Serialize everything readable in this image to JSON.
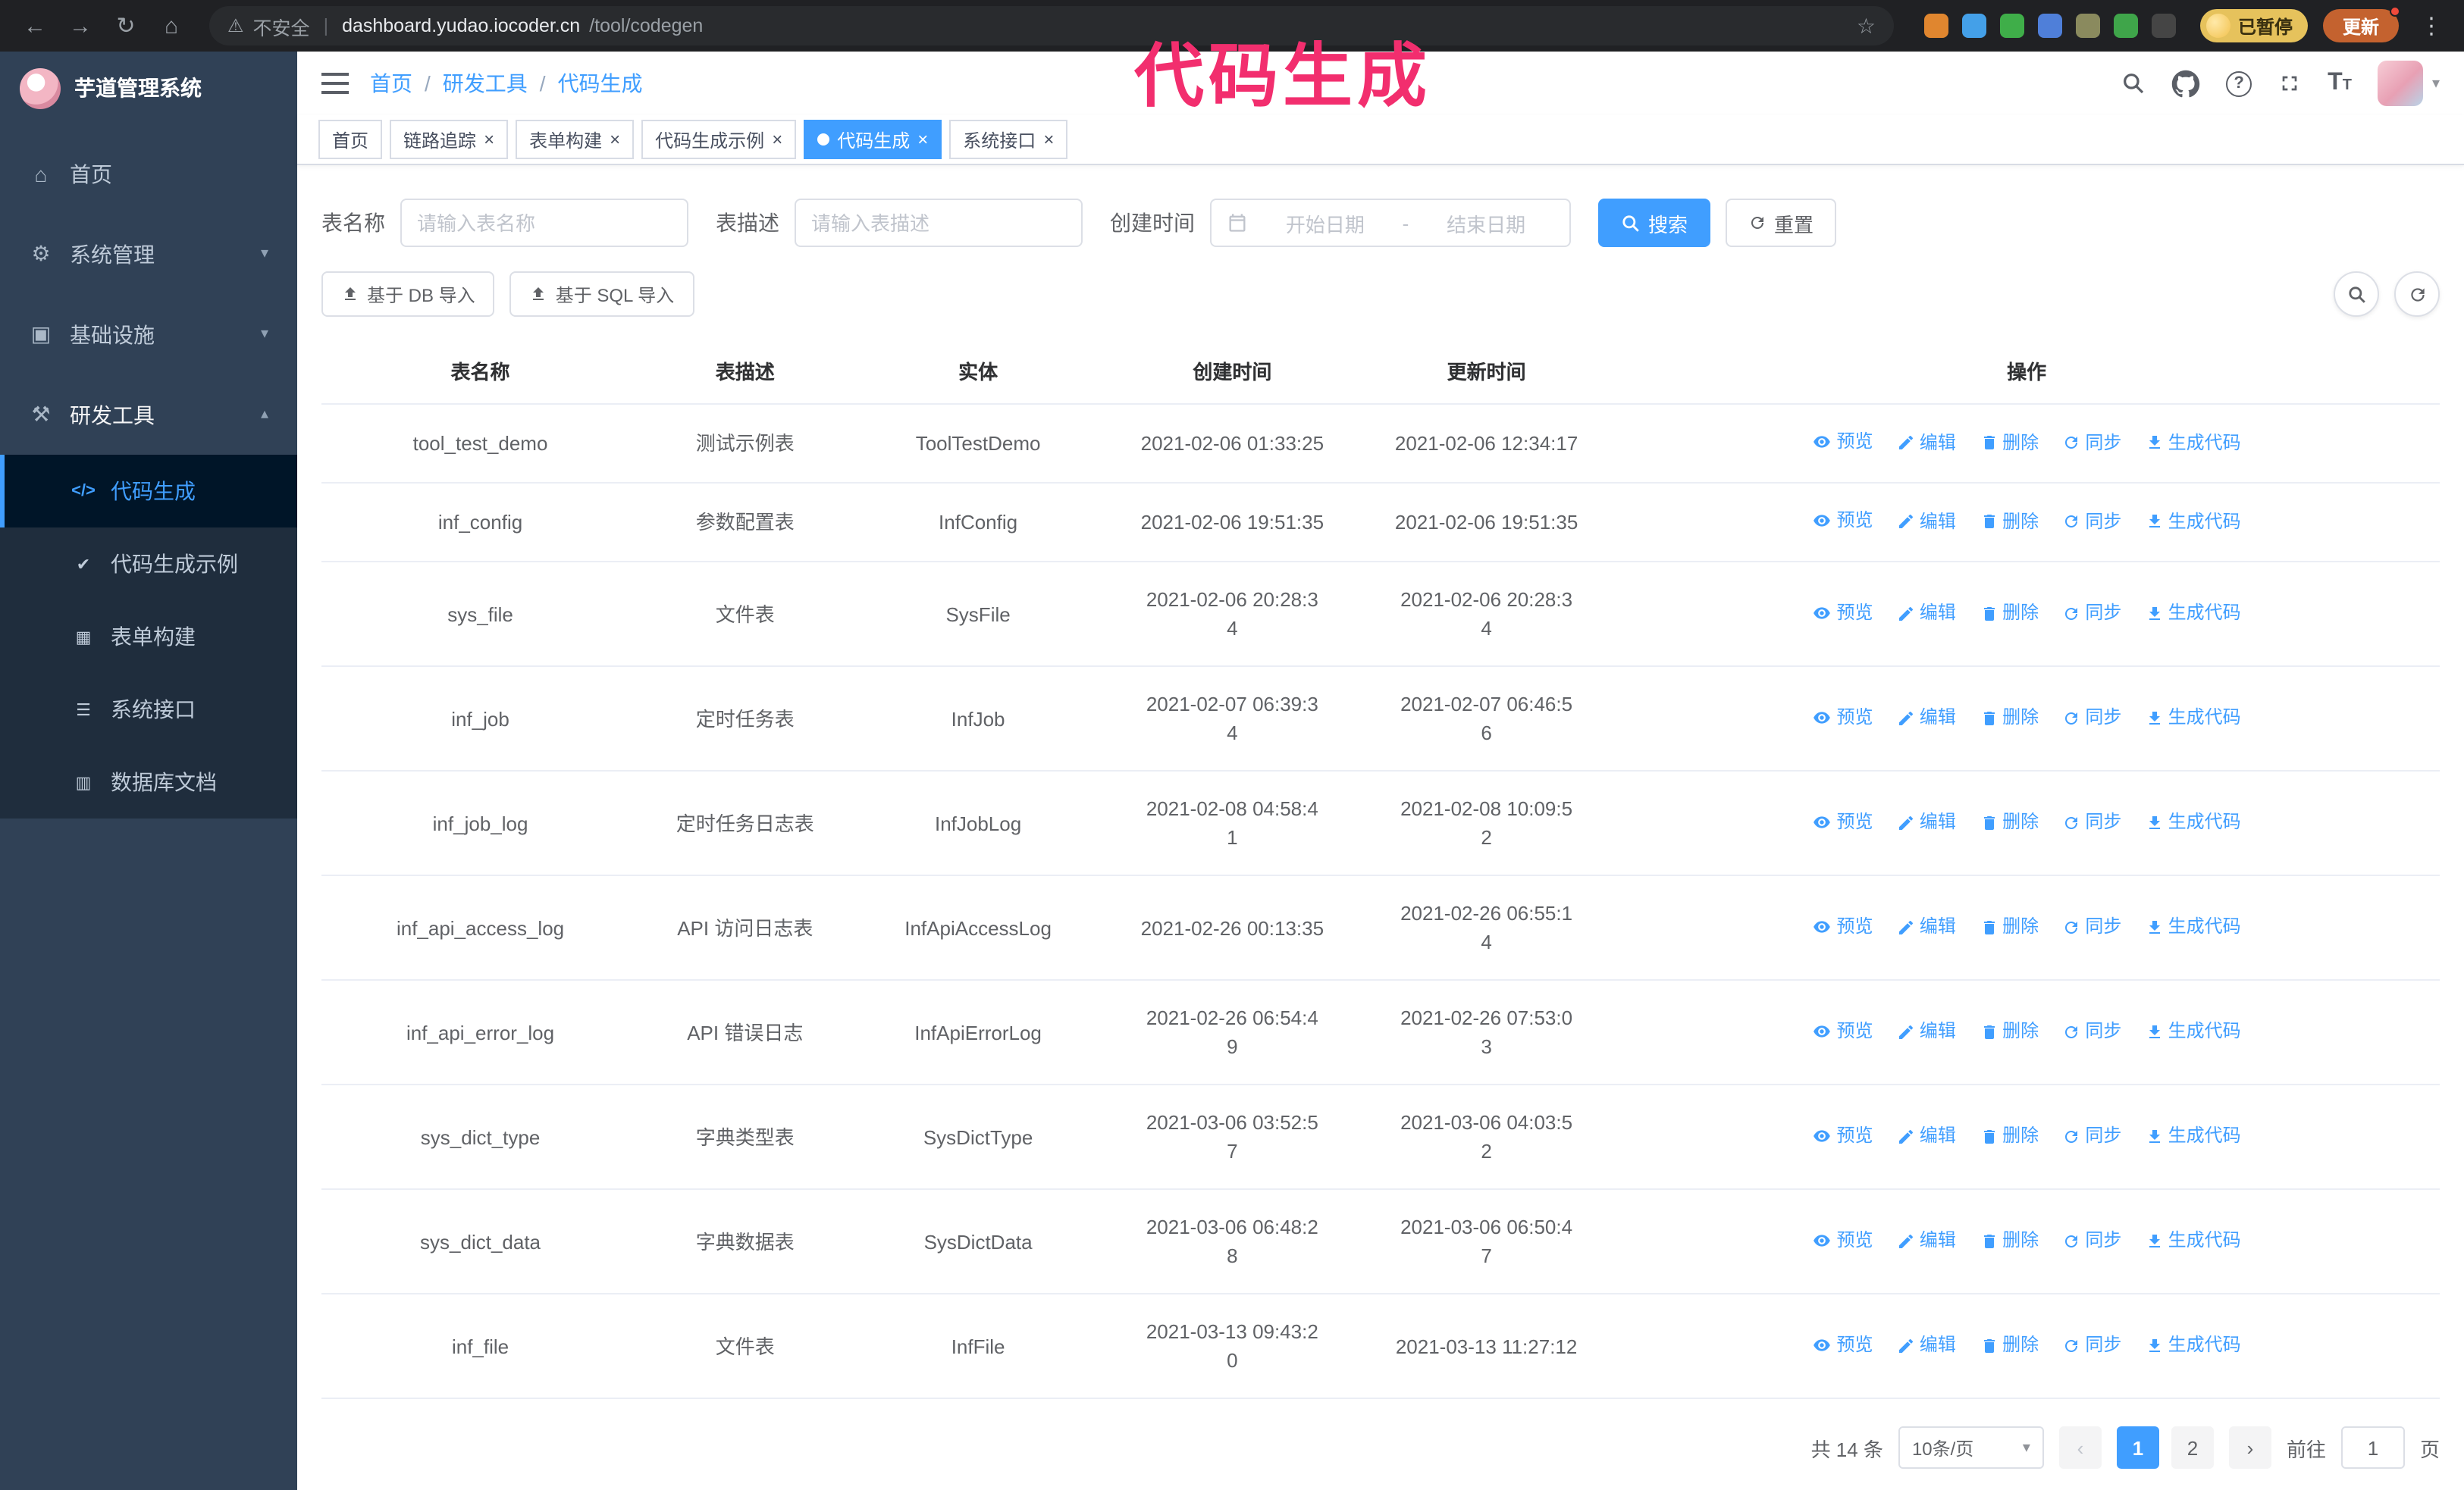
{
  "theme": {
    "primary": "#409eff",
    "sidebar_bg": "#304156",
    "submenu_bg": "#1f2d3d",
    "annotation": "#f22e6e"
  },
  "browser": {
    "security_text": "不安全",
    "url_host": "dashboard.yudao.iocoder.cn",
    "url_path": "/tool/codegen",
    "paused_badge": "已暂停",
    "update_button": "更新",
    "extension_colors": [
      "#e0862f",
      "#44a0e8",
      "#3fae49",
      "#4f7fd9",
      "#8a8a5e",
      "#3fa54a",
      "#454545"
    ]
  },
  "annotation": {
    "text": "代码生成"
  },
  "sidebar": {
    "logo_title": "芋道管理系统",
    "menu": [
      {
        "label": "首页",
        "icon": "home",
        "expandable": false,
        "expanded": false
      },
      {
        "label": "系统管理",
        "icon": "gear",
        "expandable": true,
        "expanded": false
      },
      {
        "label": "基础设施",
        "icon": "infrastructure",
        "expandable": true,
        "expanded": false
      },
      {
        "label": "研发工具",
        "icon": "tools",
        "expandable": true,
        "expanded": true
      }
    ],
    "submenu": [
      {
        "label": "代码生成",
        "icon": "code",
        "active": true
      },
      {
        "label": "代码生成示例",
        "icon": "example",
        "active": false
      },
      {
        "label": "表单构建",
        "icon": "form",
        "active": false
      },
      {
        "label": "系统接口",
        "icon": "api",
        "active": false
      },
      {
        "label": "数据库文档",
        "icon": "database",
        "active": false
      }
    ]
  },
  "header": {
    "breadcrumb": [
      "首页",
      "研发工具",
      "代码生成"
    ]
  },
  "tabs": [
    {
      "label": "首页",
      "closable": false,
      "active": false
    },
    {
      "label": "链路追踪",
      "closable": true,
      "active": false
    },
    {
      "label": "表单构建",
      "closable": true,
      "active": false
    },
    {
      "label": "代码生成示例",
      "closable": true,
      "active": false
    },
    {
      "label": "代码生成",
      "closable": true,
      "active": true
    },
    {
      "label": "系统接口",
      "closable": true,
      "active": false
    }
  ],
  "filters": {
    "table_name_label": "表名称",
    "table_name_placeholder": "请输入表名称",
    "table_desc_label": "表描述",
    "table_desc_placeholder": "请输入表描述",
    "create_time_label": "创建时间",
    "date_start_placeholder": "开始日期",
    "date_separator": "-",
    "date_end_placeholder": "结束日期",
    "search_button": "搜索",
    "reset_button": "重置"
  },
  "toolbar": {
    "import_db_button": "基于 DB 导入",
    "import_sql_button": "基于 SQL 导入"
  },
  "table": {
    "columns": [
      "表名称",
      "表描述",
      "实体",
      "创建时间",
      "更新时间",
      "操作"
    ],
    "action_labels": [
      "预览",
      "编辑",
      "删除",
      "同步",
      "生成代码"
    ],
    "rows": [
      {
        "name": "tool_test_demo",
        "desc": "测试示例表",
        "entity": "ToolTestDemo",
        "created": "2021-02-06 01:33:25",
        "updated": "2021-02-06 12:34:17"
      },
      {
        "name": "inf_config",
        "desc": "参数配置表",
        "entity": "InfConfig",
        "created": "2021-02-06 19:51:35",
        "updated": "2021-02-06 19:51:35"
      },
      {
        "name": "sys_file",
        "desc": "文件表",
        "entity": "SysFile",
        "created": "2021-02-06 20:28:3\n4",
        "updated": "2021-02-06 20:28:3\n4"
      },
      {
        "name": "inf_job",
        "desc": "定时任务表",
        "entity": "InfJob",
        "created": "2021-02-07 06:39:3\n4",
        "updated": "2021-02-07 06:46:5\n6"
      },
      {
        "name": "inf_job_log",
        "desc": "定时任务日志表",
        "entity": "InfJobLog",
        "created": "2021-02-08 04:58:4\n1",
        "updated": "2021-02-08 10:09:5\n2"
      },
      {
        "name": "inf_api_access_log",
        "desc": "API 访问日志表",
        "entity": "InfApiAccessLog",
        "created": "2021-02-26 00:13:35",
        "updated": "2021-02-26 06:55:1\n4"
      },
      {
        "name": "inf_api_error_log",
        "desc": "API 错误日志",
        "entity": "InfApiErrorLog",
        "created": "2021-02-26 06:54:4\n9",
        "updated": "2021-02-26 07:53:0\n3"
      },
      {
        "name": "sys_dict_type",
        "desc": "字典类型表",
        "entity": "SysDictType",
        "created": "2021-03-06 03:52:5\n7",
        "updated": "2021-03-06 04:03:5\n2"
      },
      {
        "name": "sys_dict_data",
        "desc": "字典数据表",
        "entity": "SysDictData",
        "created": "2021-03-06 06:48:2\n8",
        "updated": "2021-03-06 06:50:4\n7"
      },
      {
        "name": "inf_file",
        "desc": "文件表",
        "entity": "InfFile",
        "created": "2021-03-13 09:43:2\n0",
        "updated": "2021-03-13 11:27:12"
      }
    ]
  },
  "pagination": {
    "total_text": "共 14 条",
    "page_size_text": "10条/页",
    "pages": [
      "1",
      "2"
    ],
    "active_page": "1",
    "goto_prefix": "前往",
    "goto_value": "1",
    "goto_suffix": "页"
  }
}
